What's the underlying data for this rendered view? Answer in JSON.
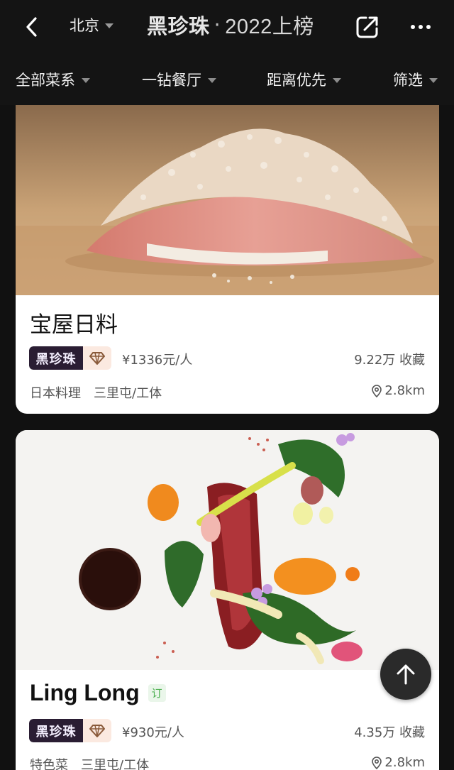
{
  "header": {
    "city": "北京",
    "title_brand": "黑珍珠",
    "title_dot": "·",
    "title_year": "2022上榜"
  },
  "filters": [
    {
      "label": "全部菜系"
    },
    {
      "label": "一钻餐厅"
    },
    {
      "label": "距离优先"
    },
    {
      "label": "筛选"
    }
  ],
  "restaurants": [
    {
      "name": "宝屋日料",
      "badge": "黑珍珠",
      "price": "¥1336元/人",
      "favorites": "9.22万 收藏",
      "cuisine": "日本料理",
      "area": "三里屯/工体",
      "distance": "2.8km"
    },
    {
      "name": "Ling Long",
      "booking_tag": "订",
      "badge": "黑珍珠",
      "price": "¥930元/人",
      "favorites": "4.35万 收藏",
      "cuisine": "特色菜",
      "area": "三里屯/工体",
      "distance": "2.8km"
    }
  ],
  "colors": {
    "background": "#111111",
    "badge_dark": "#2a1d33",
    "badge_light": "#fbe9e0",
    "booking_green": "#4caf50"
  }
}
